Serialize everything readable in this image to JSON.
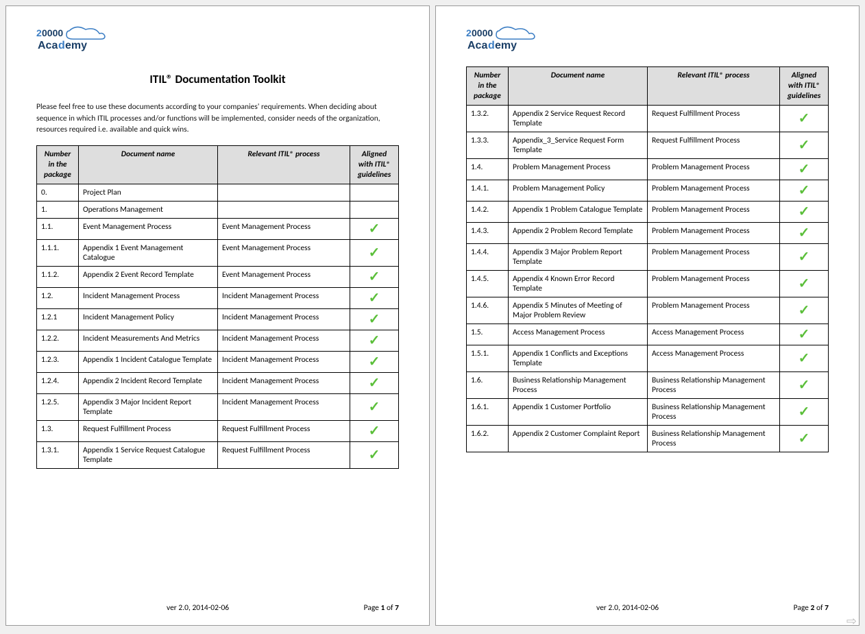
{
  "logo": {
    "top": "20000",
    "bottom": "Academy"
  },
  "title": "ITIL® Documentation Toolkit",
  "intro": "Please feel free to use these documents according to your companies' requirements. When deciding about sequence in which ITIL processes and/or functions will be implemented, consider needs of the organization, resources required i.e. available and quick wins.",
  "headers": {
    "num": "Number in the package",
    "name": "Document name",
    "proc": "Relevant ITIL® process",
    "aligned": "Aligned with ITIL® guidelines"
  },
  "footer": {
    "version": "ver  2.0, 2014-02-06",
    "page_label": "Page",
    "of_label": "of",
    "total": "7"
  },
  "pages": [
    {
      "page_num": "1",
      "show_title": true,
      "show_intro": true,
      "rows": [
        {
          "num": "0.",
          "name": "Project Plan",
          "proc": "",
          "aligned": false
        },
        {
          "num": "1.",
          "name": "Operations Management",
          "proc": "",
          "aligned": false
        },
        {
          "num": "1.1.",
          "name": "Event Management Process",
          "proc": "Event Management Process",
          "aligned": true
        },
        {
          "num": "1.1.1.",
          "name": "Appendix 1 Event Management Catalogue",
          "proc": "Event Management Process",
          "aligned": true
        },
        {
          "num": "1.1.2.",
          "name": "Appendix 2 Event Record Template",
          "proc": "Event Management Process",
          "aligned": true
        },
        {
          "num": "1.2.",
          "name": "Incident Management Process",
          "proc": "Incident Management Process",
          "aligned": true
        },
        {
          "num": "1.2.1",
          "name": "Incident Management Policy",
          "proc": "Incident Management Process",
          "aligned": true
        },
        {
          "num": "1.2.2.",
          "name": "Incident Measurements And Metrics",
          "proc": "Incident Management Process",
          "aligned": true
        },
        {
          "num": "1.2.3.",
          "name": "Appendix 1 Incident Catalogue Template",
          "proc": "Incident Management Process",
          "aligned": true
        },
        {
          "num": "1.2.4.",
          "name": "Appendix 2 Incident Record Template",
          "proc": "Incident Management Process",
          "aligned": true
        },
        {
          "num": "1.2.5.",
          "name": "Appendix 3 Major Incident Report Template",
          "proc": "Incident Management Process",
          "aligned": true
        },
        {
          "num": "1.3.",
          "name": "Request Fulfillment Process",
          "proc": "Request Fulfillment Process",
          "aligned": true
        },
        {
          "num": "1.3.1.",
          "name": "Appendix 1 Service Request Catalogue Template",
          "proc": "Request Fulfillment Process",
          "aligned": true
        }
      ]
    },
    {
      "page_num": "2",
      "show_title": false,
      "show_intro": false,
      "rows": [
        {
          "num": "1.3.2.",
          "name": "Appendix 2 Service Request Record Template",
          "proc": "Request Fulfillment Process",
          "aligned": true
        },
        {
          "num": "1.3.3.",
          "name": "Appendix_3_Service Request Form Template",
          "proc": "Request Fulfillment Process",
          "aligned": true
        },
        {
          "num": "1.4.",
          "name": "Problem Management Process",
          "proc": "Problem Management Process",
          "aligned": true
        },
        {
          "num": "1.4.1.",
          "name": "Problem Management Policy",
          "proc": "Problem Management Process",
          "aligned": true
        },
        {
          "num": "1.4.2.",
          "name": "Appendix 1 Problem Catalogue Template",
          "proc": "Problem Management Process",
          "aligned": true
        },
        {
          "num": "1.4.3.",
          "name": "Appendix 2 Problem Record Template",
          "proc": "Problem Management Process",
          "aligned": true
        },
        {
          "num": "1.4.4.",
          "name": "Appendix 3 Major Problem Report Template",
          "proc": "Problem Management Process",
          "aligned": true
        },
        {
          "num": "1.4.5.",
          "name": "Appendix 4 Known Error Record Template",
          "proc": "Problem Management Process",
          "aligned": true
        },
        {
          "num": "1.4.6.",
          "name": "Appendix 5 Minutes of Meeting of Major Problem Review",
          "proc": "Problem Management Process",
          "aligned": true
        },
        {
          "num": "1.5.",
          "name": "Access Management Process",
          "proc": "Access Management Process",
          "aligned": true
        },
        {
          "num": "1.5.1.",
          "name": "Appendix 1 Conflicts and Exceptions Template",
          "proc": "Access Management Process",
          "aligned": true
        },
        {
          "num": "1.6.",
          "name": "Business Relationship Management Process",
          "proc": "Business Relationship Management Process",
          "aligned": true
        },
        {
          "num": "1.6.1.",
          "name": "Appendix 1 Customer Portfolio",
          "proc": "Business Relationship Management Process",
          "aligned": true
        },
        {
          "num": "1.6.2.",
          "name": "Appendix 2 Customer Complaint Report",
          "proc": "Business Relationship Management Process",
          "aligned": true
        }
      ]
    }
  ]
}
